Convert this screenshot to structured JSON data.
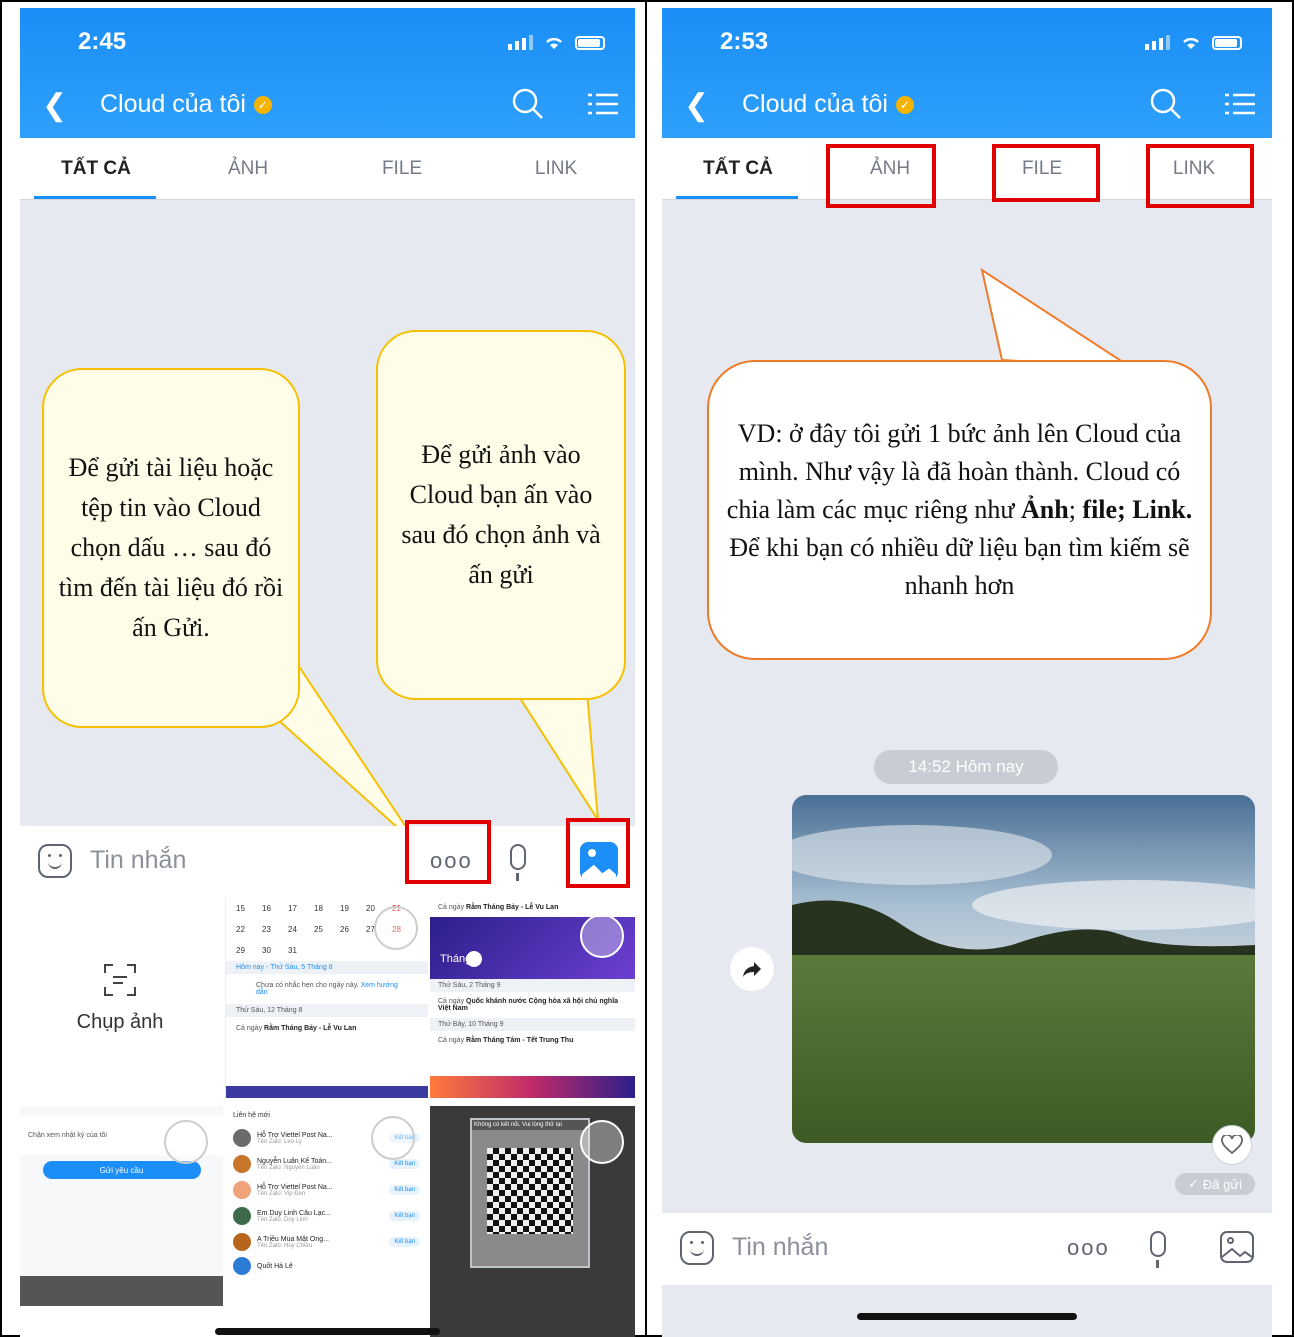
{
  "left": {
    "status_time": "2:45",
    "title": "Cloud của tôi",
    "tabs": [
      {
        "label": "TẤT CẢ",
        "active": true
      },
      {
        "label": "ẢNH",
        "active": false
      },
      {
        "label": "FILE",
        "active": false
      },
      {
        "label": "LINK",
        "active": false
      }
    ],
    "callout_docs": "Để gửi tài liệu hoặc tệp tin vào Cloud chọn dấu … sau đó tìm đến tài liệu đó rồi ấn Gửi.",
    "callout_photo": "Để gửi ảnh vào Cloud bạn ấn vào sau đó chọn ảnh và ấn gửi",
    "composer": {
      "placeholder": "Tin nhắn",
      "more": "ooo"
    },
    "gallery": {
      "camera_label": "Chụp ảnh",
      "thumb_calendar": {
        "day_rows": [
          [
            "15",
            "16",
            "17",
            "18",
            "19",
            "20",
            "21"
          ],
          [
            "22",
            "23",
            "24",
            "25",
            "26",
            "27",
            "28"
          ],
          [
            "29",
            "30",
            "31",
            "",
            "",
            "",
            ""
          ]
        ],
        "today": "Hôm nay - Thứ Sáu, 5 Tháng 8",
        "note": "Chưa có nhắc hẹn cho ngày này.",
        "note_link": "Xem hướng dẫn",
        "section": "Thứ Sáu, 12 Tháng 8",
        "event_tag": "Cả ngày",
        "event": "Rằm Tháng Bảy - Lễ Vu Lan"
      },
      "thumb_moon": {
        "event_tag": "Cả ngày",
        "event_top": "Rằm Tháng Bảy - Lễ Vu Lan",
        "banner": "Tháng",
        "section1": "Thứ Sáu, 2 Tháng 9",
        "event_mid": "Quốc khánh nước Cộng hòa xã hội chủ nghĩa Việt Nam",
        "section2": "Thứ Bảy, 10 Tháng 9",
        "event_bottom": "Rằm Tháng Tám - Tết Trung Thu"
      },
      "thumb_settings": {
        "row": "Chặn xem nhật ký của tôi",
        "button": "Gửi yêu cầu"
      },
      "thumb_contacts": {
        "header": "Liên hệ mới",
        "action": "Kết bạn",
        "items": [
          {
            "name": "Hỗ Trợ Viettel Post Na...",
            "sub": "Tên Zalo: Leo Ly"
          },
          {
            "name": "Nguyễn Luân Kế Toán...",
            "sub": "Tên Zalo: Nguyễn Luân"
          },
          {
            "name": "Hỗ Trợ Viettel Post Na...",
            "sub": "Tên Zalo: Vip Đen"
          },
          {
            "name": "Em Duy Linh Câu Lạc...",
            "sub": "Tên Zalo: Duy Linh"
          },
          {
            "name": "A Triều Mua Mật Ong...",
            "sub": "Tên Zalo: Huy Chiều"
          },
          {
            "name": "Quốt Hà Lê",
            "sub": ""
          }
        ]
      },
      "thumb_qr": {
        "banner": "Không có kết nối. Vui lòng thử lại"
      }
    }
  },
  "right": {
    "status_time": "2:53",
    "title": "Cloud của tôi",
    "tabs": [
      {
        "label": "TẤT CẢ",
        "active": true
      },
      {
        "label": "ẢNH",
        "active": false
      },
      {
        "label": "FILE",
        "active": false
      },
      {
        "label": "LINK",
        "active": false
      }
    ],
    "callout": {
      "line1": "VD: ở đây tôi gửi 1 bức ảnh lên Cloud của mình. Như vậy là đã hoàn thành. Cloud có chia làm các mục riêng như ",
      "bold1": "Ảnh",
      "sep": "; ",
      "bold2": "file; Link.",
      "line2": " Để khi bạn có nhiều dữ liệu bạn tìm kiếm sẽ nhanh hơn"
    },
    "timestamp": "14:52 Hôm nay",
    "sent_label": "Đã gửi",
    "composer": {
      "placeholder": "Tin nhắn",
      "more": "ooo"
    }
  },
  "colors": {
    "header_blue": "#1b8ef7",
    "highlight_red": "#e00000",
    "callout_yellow_border": "#f5c000",
    "callout_orange_border": "#ee7b29"
  },
  "icons": [
    "back-icon",
    "verified-icon",
    "search-icon",
    "menu-list-icon",
    "emoji-icon",
    "more-icon",
    "mic-icon",
    "image-icon",
    "scan-icon",
    "share-icon",
    "heart-icon",
    "check-icon"
  ]
}
